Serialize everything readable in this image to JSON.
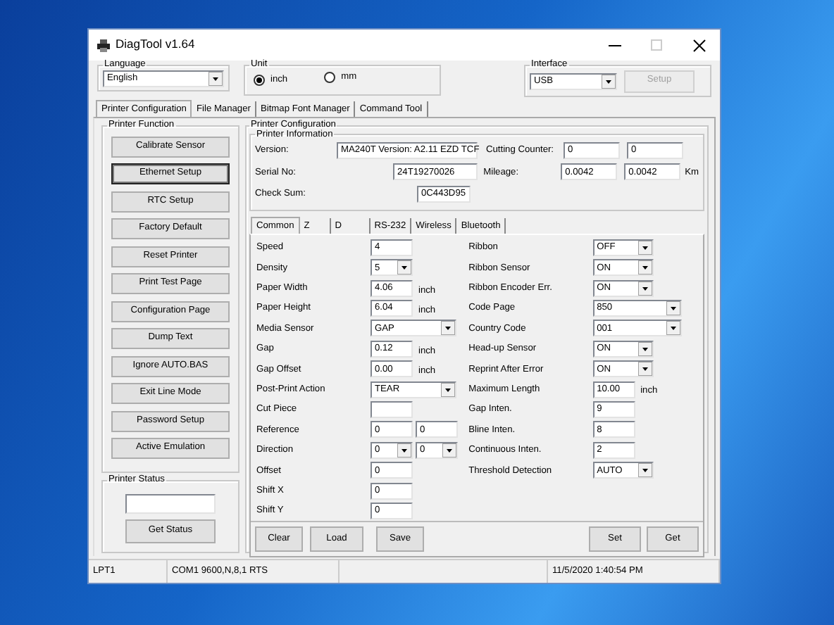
{
  "window": {
    "title": "DiagTool v1.64"
  },
  "language": {
    "label": "Language",
    "value": "English"
  },
  "unit": {
    "label": "Unit",
    "options": [
      {
        "label": "inch",
        "selected": true
      },
      {
        "label": "mm",
        "selected": false
      }
    ]
  },
  "interface": {
    "label": "Interface",
    "value": "USB",
    "button": {
      "label": "Setup",
      "disabled": true
    }
  },
  "tabs": [
    {
      "label": "Printer Configuration",
      "selected": true
    },
    {
      "label": "File Manager",
      "selected": false
    },
    {
      "label": "Bitmap Font Manager",
      "selected": false
    },
    {
      "label": "Command Tool",
      "selected": false
    }
  ],
  "printer_function": {
    "title": "Printer Function",
    "buttons": [
      {
        "label": "Calibrate Sensor",
        "focused": false
      },
      {
        "label": "Ethernet Setup",
        "focused": true
      },
      {
        "label": "RTC Setup",
        "focused": false
      },
      {
        "label": "Factory Default",
        "focused": false
      },
      {
        "label": "Reset Printer",
        "focused": false
      },
      {
        "label": "Print Test Page",
        "focused": false
      },
      {
        "label": "Configuration Page",
        "focused": false
      },
      {
        "label": "Dump Text",
        "focused": false
      },
      {
        "label": "Ignore AUTO.BAS",
        "focused": false
      },
      {
        "label": "Exit Line Mode",
        "focused": false
      },
      {
        "label": "Password Setup",
        "focused": false
      },
      {
        "label": "Active Emulation",
        "focused": false
      }
    ]
  },
  "printer_status": {
    "title": "Printer Status",
    "button": "Get Status"
  },
  "printer_configuration": {
    "title": "Printer Configuration",
    "information": {
      "title": "Printer Information",
      "rows": [
        [
          {
            "label": "Version:",
            "values": [
              "MA240T Version: A2.11 EZD TCF"
            ]
          },
          {
            "label": "Cutting Counter:",
            "values": [
              "0",
              "0"
            ]
          }
        ],
        [
          {
            "label": "Serial No:",
            "values": [
              "24T19270026"
            ]
          },
          {
            "label": "Mileage:",
            "values": [
              "0.0042",
              "0.0042"
            ],
            "unit": "Km"
          }
        ],
        [
          {
            "label": "Check Sum:",
            "values": [
              "0C443D95"
            ]
          }
        ]
      ]
    },
    "subtabs": [
      {
        "label": "Common",
        "selected": true
      },
      {
        "label": "Z",
        "selected": false
      },
      {
        "label": "D",
        "selected": false
      },
      {
        "label": "RS-232",
        "selected": false
      },
      {
        "label": "Wireless",
        "selected": false
      },
      {
        "label": "Bluetooth",
        "selected": false
      }
    ],
    "left_settings": [
      {
        "label": "Speed",
        "kind": "text",
        "values": [
          "4"
        ]
      },
      {
        "label": "Density",
        "kind": "dropdown",
        "values": [
          "5"
        ]
      },
      {
        "label": "Paper Width",
        "kind": "text",
        "values": [
          "4.06"
        ],
        "unit": "inch"
      },
      {
        "label": "Paper Height",
        "kind": "text",
        "values": [
          "6.04"
        ],
        "unit": "inch"
      },
      {
        "label": "Media Sensor",
        "kind": "long_dropdown",
        "values": [
          "GAP"
        ]
      },
      {
        "label": "Gap",
        "kind": "text",
        "values": [
          "0.12"
        ],
        "unit": "inch"
      },
      {
        "label": "Gap Offset",
        "kind": "text",
        "values": [
          "0.00"
        ],
        "unit": "inch"
      },
      {
        "label": "Post-Print Action",
        "kind": "long_dropdown",
        "values": [
          "TEAR"
        ]
      },
      {
        "label": "Cut Piece",
        "kind": "text"
      },
      {
        "label": "Reference",
        "kind": "text",
        "values": [
          "0",
          "0"
        ]
      },
      {
        "label": "Direction",
        "kind": "dropdown",
        "values": [
          "0",
          "0"
        ]
      },
      {
        "label": "Offset",
        "kind": "text",
        "values": [
          "0"
        ]
      },
      {
        "label": "Shift X",
        "kind": "text",
        "values": [
          "0"
        ]
      },
      {
        "label": "Shift Y",
        "kind": "text",
        "values": [
          "0"
        ]
      }
    ],
    "right_settings": [
      {
        "label": "Ribbon",
        "kind": "dropdown",
        "values": [
          "OFF"
        ]
      },
      {
        "label": "Ribbon Sensor",
        "kind": "dropdown",
        "values": [
          "ON"
        ]
      },
      {
        "label": "Ribbon Encoder Err.",
        "kind": "dropdown",
        "values": [
          "ON"
        ]
      },
      {
        "label": "Code Page",
        "kind": "long_dropdown",
        "values": [
          "850"
        ]
      },
      {
        "label": "Country Code",
        "kind": "long_dropdown",
        "values": [
          "001"
        ]
      },
      {
        "label": "Head-up Sensor",
        "kind": "dropdown",
        "values": [
          "ON"
        ]
      },
      {
        "label": "Reprint After Error",
        "kind": "dropdown",
        "values": [
          "ON"
        ]
      },
      {
        "label": "Maximum Length",
        "kind": "text",
        "values": [
          "10.00"
        ],
        "unit": "inch"
      },
      {
        "label": "Gap Inten.",
        "kind": "text",
        "values": [
          "9"
        ]
      },
      {
        "label": "Bline Inten.",
        "kind": "text",
        "values": [
          "8"
        ]
      },
      {
        "label": "Continuous Inten.",
        "kind": "text",
        "values": [
          "2"
        ]
      },
      {
        "label": "Threshold Detection",
        "kind": "dropdown",
        "values": [
          "AUTO"
        ]
      }
    ],
    "left_buttons": [
      "Clear",
      "Load",
      "Save"
    ],
    "right_buttons": [
      "Set",
      "Get"
    ]
  },
  "status_bar": [
    {
      "text": "LPT1"
    },
    {
      "text": "COM1 9600,N,8,1 RTS"
    },
    {
      "text": "11/5/2020 1:40:54 PM"
    }
  ]
}
